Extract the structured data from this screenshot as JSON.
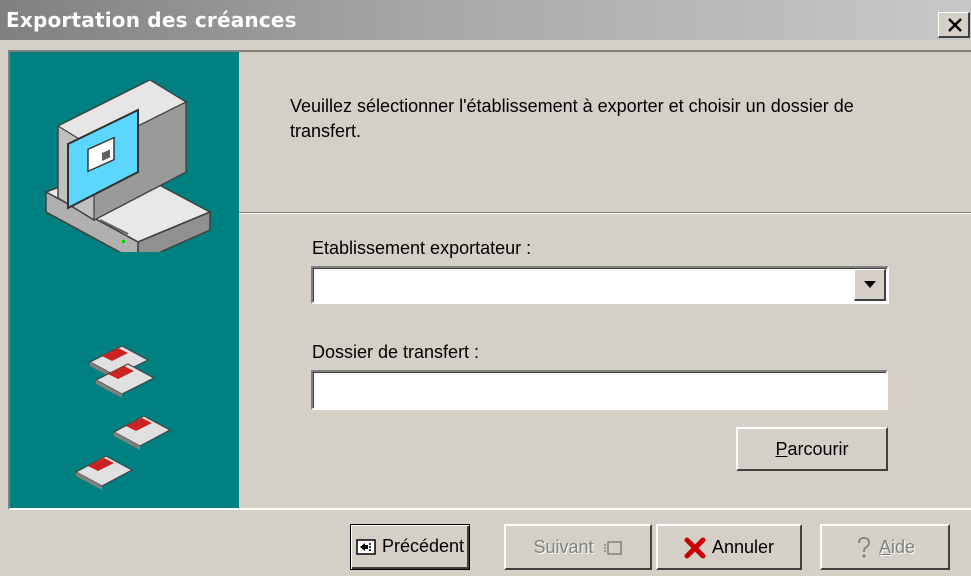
{
  "window": {
    "title": "Exportation des créances"
  },
  "icons": {
    "close": "close-icon",
    "computer": "computer-icon",
    "floppies": "floppy-disk-icon",
    "combo_arrow": "chevron-down-icon",
    "prev": "back-arrow-icon",
    "next": "next-icon",
    "cancel": "red-x-icon",
    "help": "question-icon"
  },
  "main": {
    "intro_text": "Veuillez sélectionner l'établissement à exporter et choisir un dossier de transfert.",
    "establishment_label": "Etablissement exportateur :",
    "establishment_value": "",
    "folder_label": "Dossier de transfert :",
    "folder_value": "",
    "browse_first": "P",
    "browse_rest": "arcourir"
  },
  "footer": {
    "prev_label": "Précédent",
    "next_label": "Suivant",
    "cancel_label": "Annuler",
    "help_first": "A",
    "help_rest": "ide"
  },
  "colors": {
    "side_panel": "#008080",
    "face": "#d4d0c8",
    "cancel_x": "#cc0000"
  }
}
